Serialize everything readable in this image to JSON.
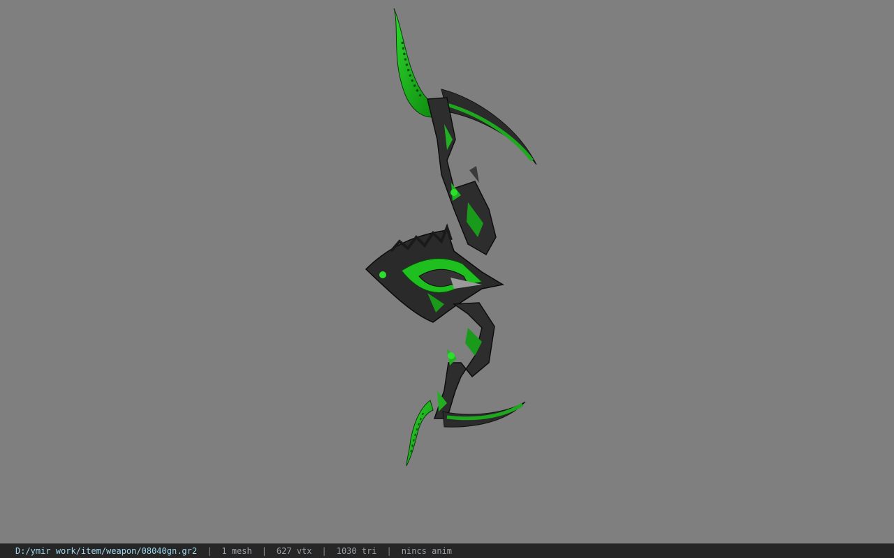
{
  "viewport": {
    "background": "#7f7f7f",
    "model": {
      "icon": "bow-weapon-model",
      "colors": {
        "green": "#1fbf1f",
        "dark": "#2a2a2a",
        "metal": "#9a9a9a"
      }
    }
  },
  "statusbar": {
    "path": "D:/ymir work/item/weapon/08040gn.gr2",
    "separator": "|",
    "mesh": "1 mesh",
    "vtx": "627 vtx",
    "tri": "1030 tri",
    "anim": "nincs anim"
  }
}
